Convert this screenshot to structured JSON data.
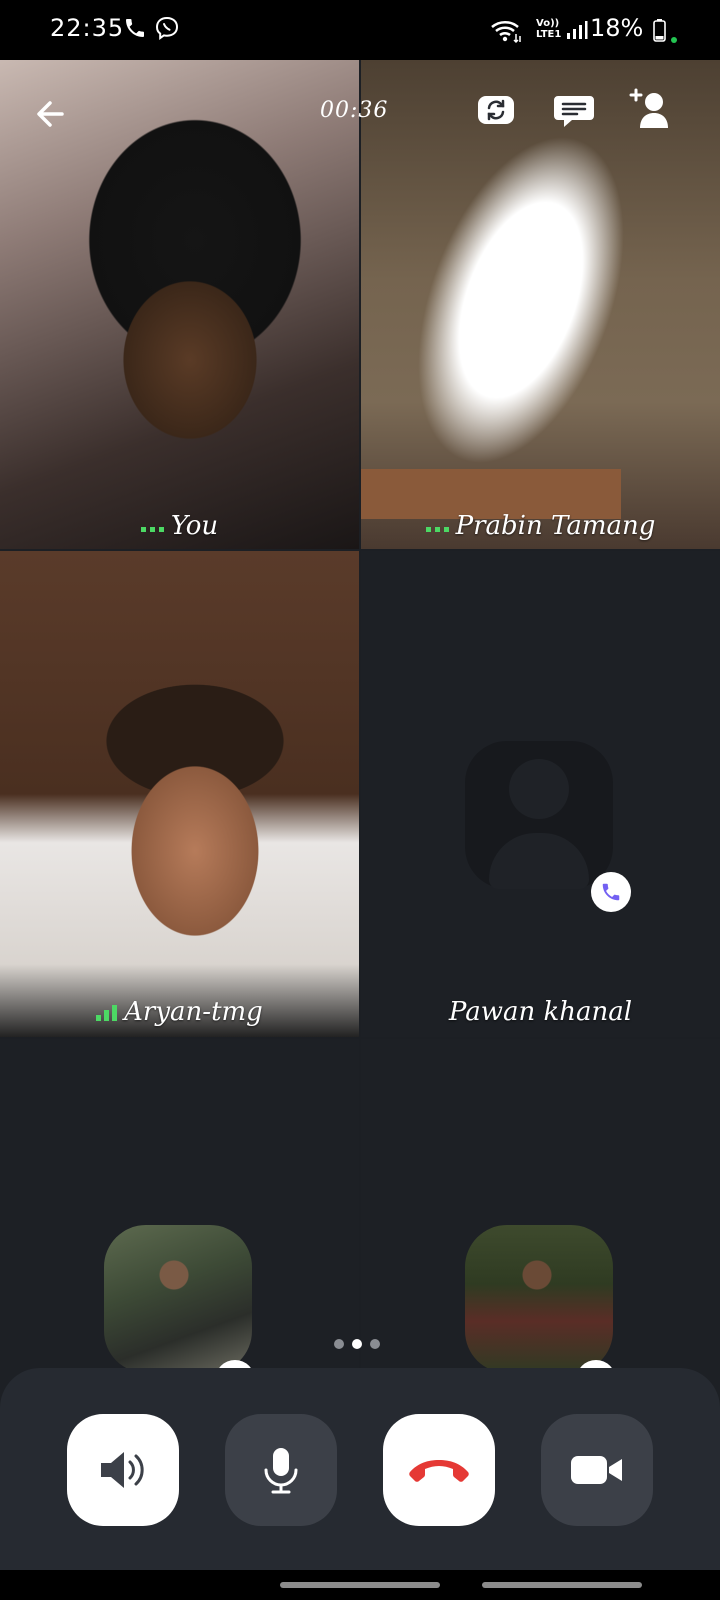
{
  "status_bar": {
    "time": "22:35",
    "battery": "18%",
    "icons": [
      "phone-icon",
      "viber-icon",
      "wifi-icon",
      "volte-icon",
      "signal-icon",
      "battery-icon"
    ],
    "volte_top": "Vo))",
    "volte_bottom": "LTE1"
  },
  "call": {
    "timer": "00:36",
    "accent_color": "#7360f2",
    "end_call_color": "#e53935"
  },
  "participants": [
    {
      "name": "You",
      "signal": "good"
    },
    {
      "name": "Prabin Tamang",
      "signal": "good"
    },
    {
      "name": "Aryan-tmg",
      "signal": "good"
    },
    {
      "name": "Pawan khanal",
      "status": "calling"
    },
    {
      "name": "",
      "status": "calling"
    },
    {
      "name": "",
      "status": "calling"
    }
  ],
  "pager": {
    "pages": 3,
    "active": 2
  },
  "controls": [
    "speaker-icon",
    "microphone-icon",
    "end-call-icon",
    "video-camera-icon"
  ]
}
